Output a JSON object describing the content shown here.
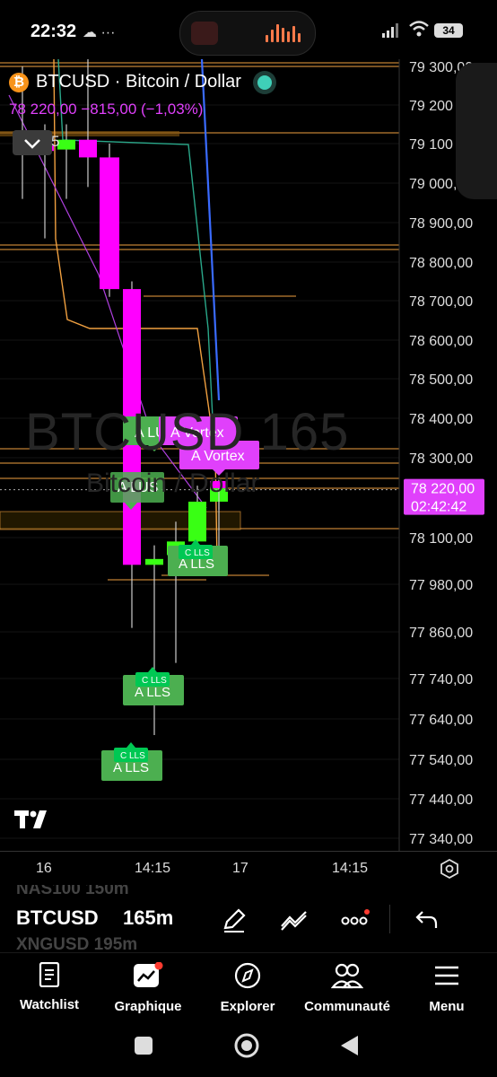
{
  "status_bar": {
    "time": "22:32",
    "extra_icons": "☁ ···",
    "battery": "34"
  },
  "symbol": {
    "name": "BTCUSD · Bitcoin / Dollar",
    "badge": "₿",
    "price_change": "78 220,00  −815,00 (−1,03%)",
    "interval_indicator": "5"
  },
  "watermark": {
    "line1": "BTCUSD 165",
    "line2": "Bitcoin / Dollar"
  },
  "price_axis": {
    "labels": [
      "79 300,00",
      "79 200",
      "79 100",
      "79 000,",
      "78 900,00",
      "78 800,00",
      "78 700,00",
      "78 600,00",
      "78 500,00",
      "78 400,00",
      "78 300,00",
      "78 100,00",
      "77 980,00",
      "77 860,00",
      "77 740,00",
      "77 640,00",
      "77 540,00",
      "77 440,00",
      "77 340,00"
    ],
    "current_price": "78 220,00",
    "countdown": "02:42:42"
  },
  "annotations": {
    "a_lus_1": "A LUS",
    "a_lus_2": "A LUS",
    "a_vortex_1": "A Vortex",
    "a_vortex_2": "A Vortex",
    "c_lls_1": "C LLS",
    "a_lls_1": "A LLS",
    "c_lls_2": "C LLS",
    "a_lls_2": "A LLS",
    "c_lls_3": "C LLS",
    "a_lls_3": "A LLS"
  },
  "chart_data": {
    "type": "candlestick",
    "symbol": "BTCUSD",
    "interval": "165m",
    "x_labels": [
      "16",
      "14:15",
      "17",
      "14:15"
    ],
    "y_ticks": [
      79300,
      79200,
      79100,
      79000,
      78900,
      78800,
      78700,
      78600,
      78500,
      78400,
      78300,
      78100,
      77980,
      77860,
      77740,
      77640,
      77540,
      77440,
      77340
    ],
    "ylim": [
      77320,
      79340
    ],
    "current_price": 78220,
    "candles": [
      {
        "open": 79130,
        "close": 79085,
        "high": 79300,
        "low": 78960,
        "color": "magenta"
      },
      {
        "open": 79095,
        "close": 79085,
        "high": 79150,
        "low": 78860,
        "color": "magenta"
      },
      {
        "open": 79085,
        "close": 79110,
        "high": 79150,
        "low": 78960,
        "color": "green"
      },
      {
        "open": 79110,
        "close": 79065,
        "high": 79340,
        "low": 78990,
        "color": "magenta"
      },
      {
        "open": 79065,
        "close": 78730,
        "high": 79100,
        "low": 78710,
        "color": "magenta"
      },
      {
        "open": 78730,
        "close": 78030,
        "high": 78750,
        "low": 77870,
        "color": "magenta"
      },
      {
        "open": 78030,
        "close": 78045,
        "high": 78080,
        "low": 77600,
        "color": "green"
      },
      {
        "open": 78055,
        "close": 78090,
        "high": 78140,
        "low": 77780,
        "color": "green"
      },
      {
        "open": 78090,
        "close": 78190,
        "high": 78230,
        "low": 78010,
        "color": "green"
      },
      {
        "open": 78190,
        "close": 78235,
        "high": 78250,
        "low": 78040,
        "color": "green"
      },
      {
        "open": 78235,
        "close": 78220,
        "high": 78250,
        "low": 78170,
        "color": "magenta"
      }
    ],
    "grid": true
  },
  "time_axis": {
    "labels": [
      "16",
      "14:15",
      "17",
      "14:15"
    ]
  },
  "symbol_tabs": {
    "prev": "NAS100  150m",
    "current_symbol": "BTCUSD",
    "current_interval": "165m",
    "next": "XNGUSD  195m"
  },
  "bottom_nav": {
    "items": [
      "Watchlist",
      "Graphique",
      "Explorer",
      "Communauté",
      "Menu"
    ]
  },
  "colors": {
    "bull": "#39ff14",
    "bear": "#ff00ff",
    "label_green": "#4caf50",
    "label_magenta": "#e040fb",
    "orange_line": "#f0a040"
  }
}
